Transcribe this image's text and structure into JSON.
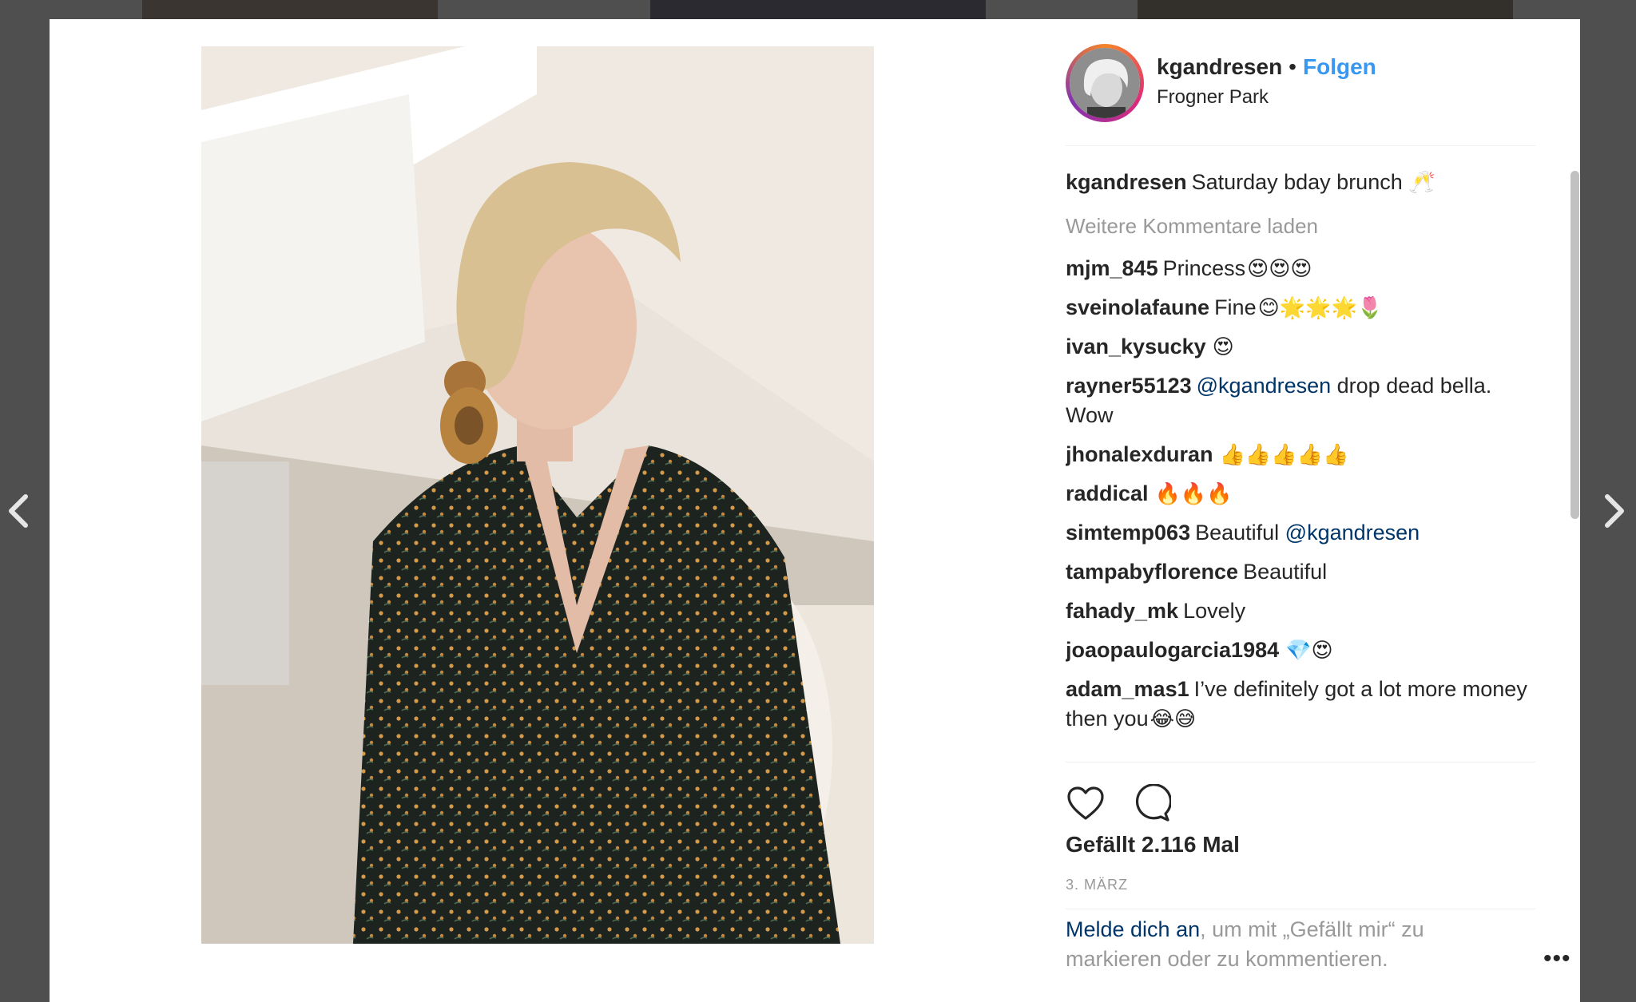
{
  "post": {
    "username": "kgandresen",
    "separator": "•",
    "follow_label": "Folgen",
    "location": "Frogner Park"
  },
  "caption": {
    "username": "kgandresen",
    "text": "Saturday bday brunch 🥂"
  },
  "load_more_label": "Weitere Kommentare laden",
  "comments": [
    {
      "username": "mjm_845",
      "text": "Princess",
      "emoji": "😍😍😍"
    },
    {
      "username": "sveinolafaune",
      "text": "Fine",
      "emoji": "😊🌟🌟🌟🌷"
    },
    {
      "username": "ivan_kysucky",
      "text": "",
      "emoji": "😍"
    },
    {
      "username": "rayner55123",
      "mention": "@kgandresen",
      "text": " drop dead bella. Wow",
      "emoji": ""
    },
    {
      "username": "jhonalexduran",
      "text": "",
      "emoji": "👍👍👍👍👍"
    },
    {
      "username": "raddical",
      "text": "",
      "emoji": "🔥🔥🔥"
    },
    {
      "username": "simtemp063",
      "text": "Beautiful ",
      "mention": "@kgandresen",
      "emoji": ""
    },
    {
      "username": "tampabyflorence",
      "text": "Beautiful",
      "emoji": ""
    },
    {
      "username": "fahady_mk",
      "text": "Lovely",
      "emoji": ""
    },
    {
      "username": "joaopaulogarcia1984",
      "text": "",
      "emoji": "💎😍"
    },
    {
      "username": "adam_mas1",
      "text": "I’ve definitely got a lot more money then you",
      "emoji": "😂😅"
    }
  ],
  "likes_label": "Gefällt 2.116 Mal",
  "date_label": "3. MÄRZ",
  "login_prompt": {
    "link": "Melde dich an",
    "text": ", um mit „Gefällt mir“ zu markieren oder zu kommentieren."
  },
  "more_options": "•••",
  "icons": {
    "like": "heart-icon",
    "comment": "comment-bubble-icon",
    "prev": "chevron-left-icon",
    "next": "chevron-right-icon"
  },
  "colors": {
    "accent": "#3897f0",
    "link": "#003569",
    "muted": "#999999",
    "text": "#262626"
  }
}
